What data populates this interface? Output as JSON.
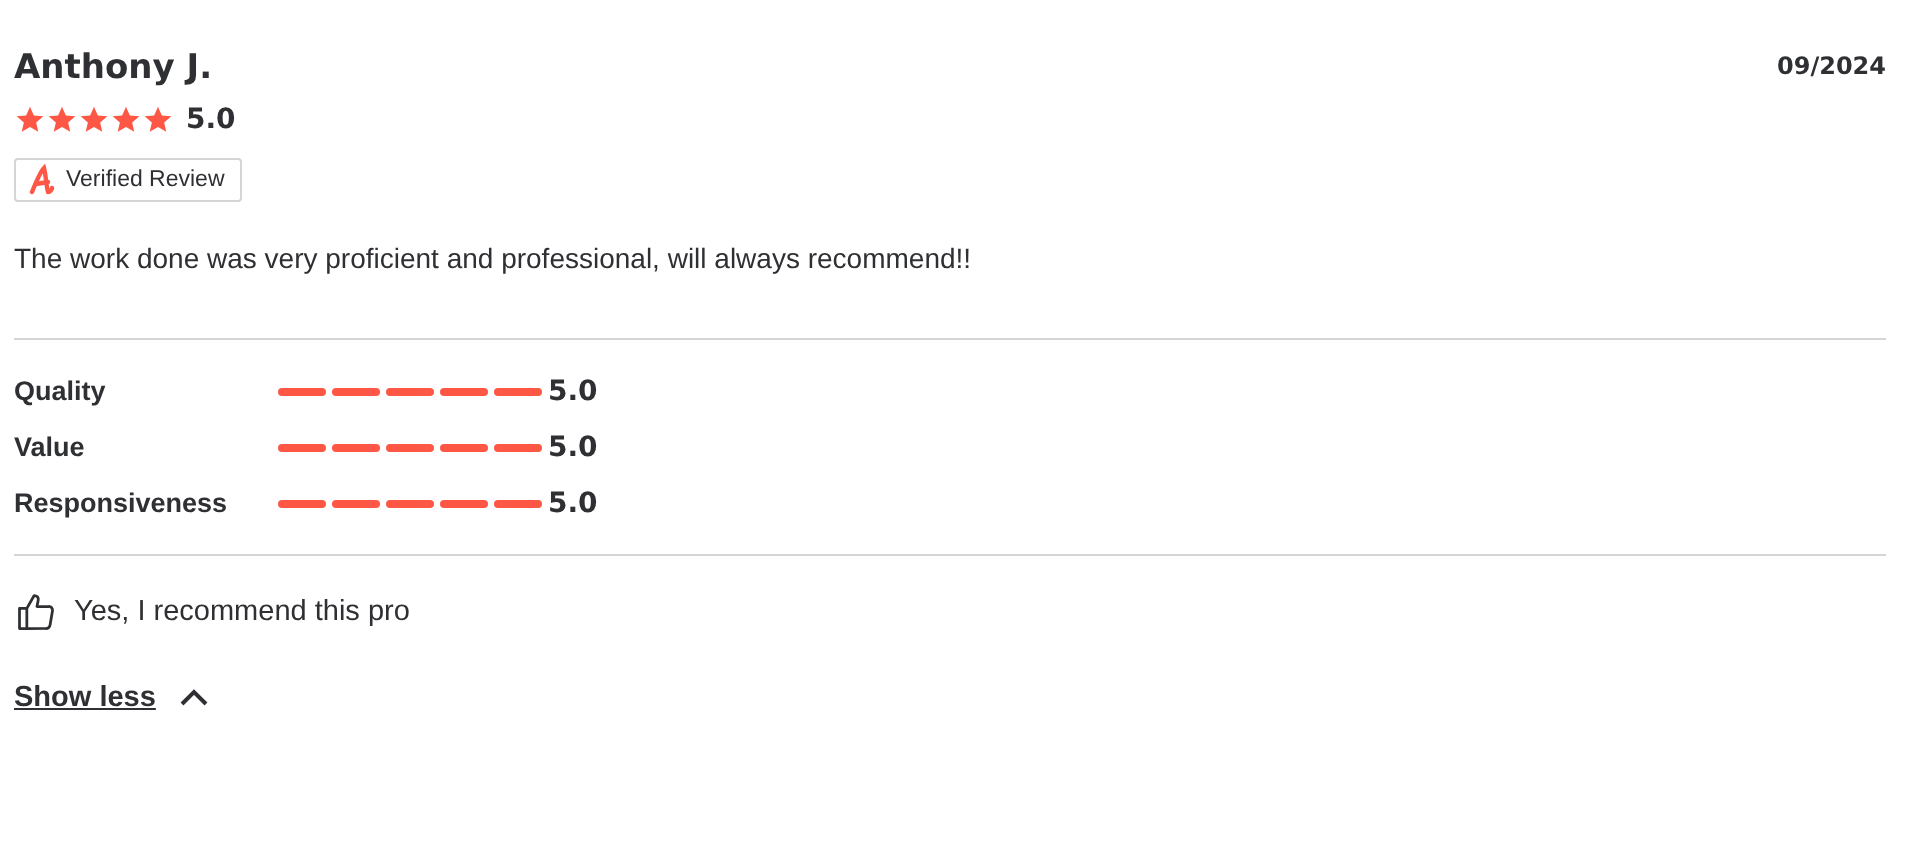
{
  "review": {
    "author": "Anthony J.",
    "date": "09/2024",
    "stars": 5,
    "rating": "5.0",
    "badge": "Verified Review",
    "text": "The work done was very proficient and professional, will always recommend!!"
  },
  "criteria": [
    {
      "label": "Quality",
      "stars": 5,
      "rating": "5.0"
    },
    {
      "label": "Value",
      "stars": 5,
      "rating": "5.0"
    },
    {
      "label": "Responsiveness",
      "stars": 5,
      "rating": "5.0"
    }
  ],
  "recommendation": {
    "recommended": true,
    "text": "Yes, I recommend this pro"
  },
  "toggle": {
    "label": "Show less",
    "expanded": true
  }
}
